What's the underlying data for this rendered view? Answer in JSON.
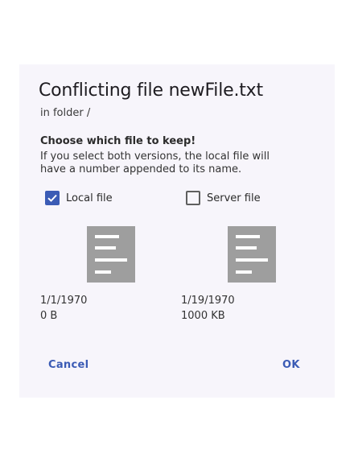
{
  "dialog": {
    "title": "Conflicting file newFile.txt",
    "subtitle": "in folder /",
    "heading": "Choose which file to keep!",
    "description": "If you select both versions, the local file will have a number appended to its name.",
    "local": {
      "label": "Local file",
      "checked": true,
      "date": "1/1/1970",
      "size": "0 B"
    },
    "server": {
      "label": "Server file",
      "checked": false,
      "date": "1/19/1970",
      "size": "1000 KB"
    },
    "cancel_label": "Cancel",
    "ok_label": "OK"
  },
  "colors": {
    "accent": "#3b5bb5",
    "icon_gray": "#9e9e9e",
    "dialog_bg": "#f7f5fb"
  },
  "icons": {
    "checked": "check-icon",
    "file": "document-icon"
  }
}
